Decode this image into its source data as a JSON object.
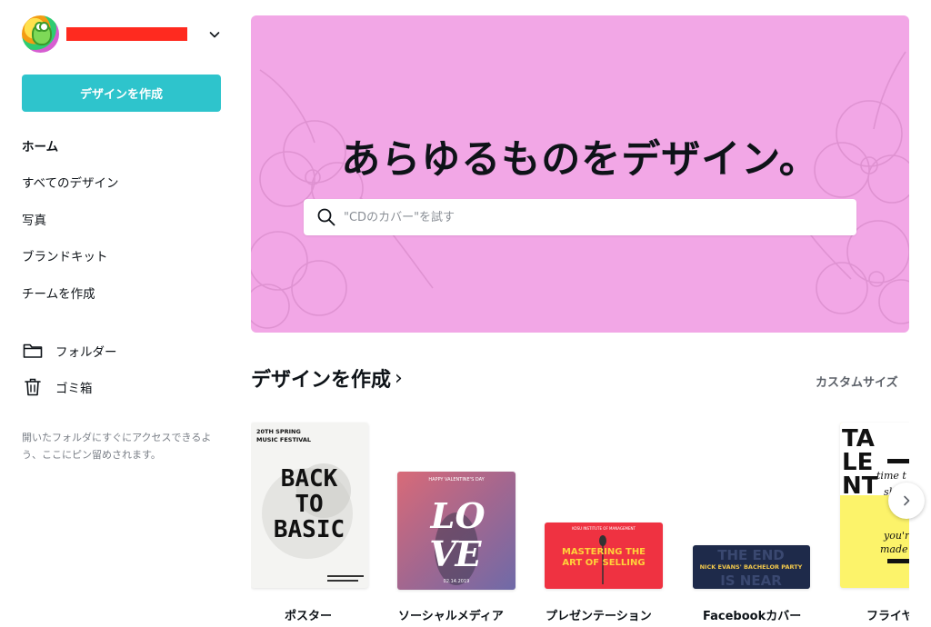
{
  "account": {
    "name": "▇▇▇▇▇▇▇▇"
  },
  "sidebar": {
    "create_label": "デザインを作成",
    "items": [
      {
        "label": "ホーム"
      },
      {
        "label": "すべてのデザイン"
      },
      {
        "label": "写真"
      },
      {
        "label": "ブランドキット"
      },
      {
        "label": "チームを作成"
      }
    ],
    "folder_label": "フォルダー",
    "trash_label": "ゴミ箱",
    "pin_hint": "開いたフォルダにすぐにアクセスできるよう、ここにピン留めされます。"
  },
  "hero": {
    "title": "あらゆるものをデザイン。",
    "search_placeholder": "\"CDのカバー\"を試す"
  },
  "section": {
    "title": "デザインを作成",
    "custom_size": "カスタムサイズ"
  },
  "templates": [
    {
      "label": "ポスター",
      "thumb_top": "20TH SPRING MUSIC FESTIVAL",
      "thumb_main": "BACK TO BASIC"
    },
    {
      "label": "ソーシャルメディア",
      "thumb_top": "HAPPY VALENTINE'S DAY",
      "thumb_main": "LOVE",
      "thumb_date": "02.14.2019"
    },
    {
      "label": "プレゼンテーション",
      "thumb_top": "KOSU INSTITUTE OF MANAGEMENT",
      "thumb_main": "MASTERING THE ART OF SELLING"
    },
    {
      "label": "Facebookカバー",
      "thumb_main": "NICK EVANS' BACHELOR PARTY",
      "thumb_bg": "THE END IS NEAR"
    },
    {
      "label": "フライヤ",
      "thumb_main": "TALENT",
      "thumb_side": "time to show made you're made"
    }
  ],
  "colors": {
    "accent": "#2ec4cc",
    "hero_bg": "#f2a7e6",
    "redaction": "#ff2a1f"
  }
}
